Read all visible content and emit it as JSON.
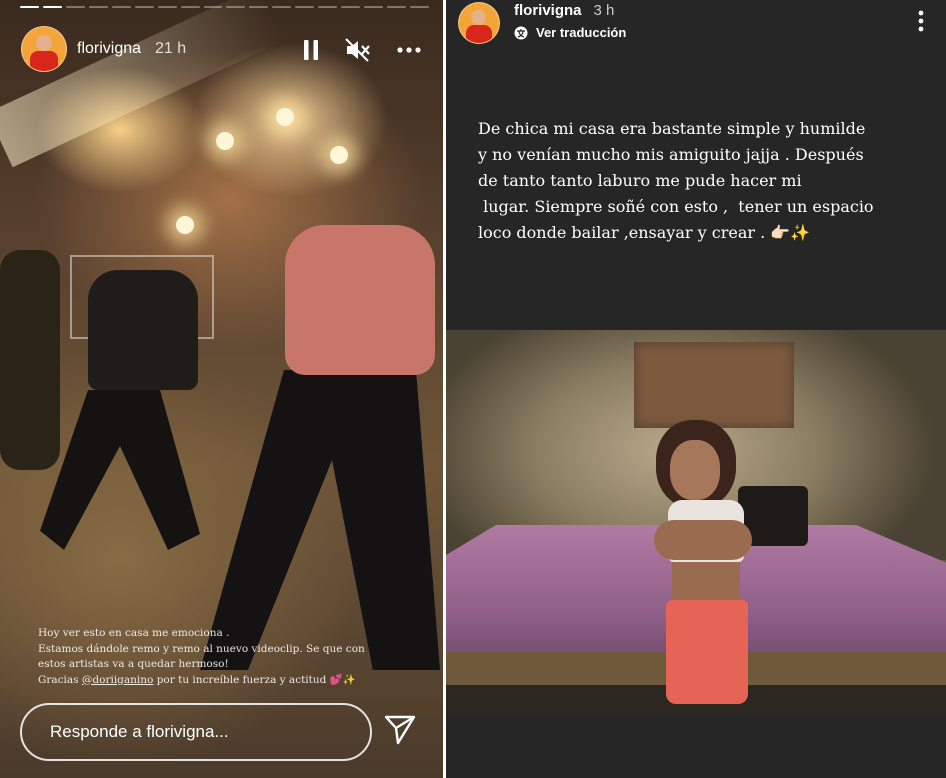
{
  "left_story": {
    "progress_segments": [
      {
        "done": true
      },
      {
        "done": true
      },
      {
        "done": false
      },
      {
        "done": false
      },
      {
        "done": false
      },
      {
        "done": false
      },
      {
        "done": false
      },
      {
        "done": false
      },
      {
        "done": false
      },
      {
        "done": false
      },
      {
        "done": false
      },
      {
        "done": false
      },
      {
        "done": false
      },
      {
        "done": false
      },
      {
        "done": false
      },
      {
        "done": false
      },
      {
        "done": false
      },
      {
        "done": false
      }
    ],
    "username": "florivigna",
    "time": "21 h",
    "caption": {
      "line1": "Hoy ver esto en casa me emociona .",
      "line2": "Estamos dándole remo y remo al nuevo videoclip. Se que con",
      "line3": "estos artistas va a quedar hermoso!",
      "line4_pre": "Gracias ",
      "line4_mention": "@doriiganino",
      "line4_post": " por tu increíble fuerza y actitud 💕✨"
    },
    "reply_placeholder": "Responde a florivigna..."
  },
  "right_story": {
    "username": "florivigna",
    "time": "3 h",
    "translate_label": "Ver traducción",
    "text_lines": [
      "De chica mi casa era bastante simple y humilde",
      "y no venían mucho mis amiguito jajja . Después",
      "de tanto tanto laburo me pude hacer mi",
      " lugar. Siempre soñé con esto ,  tener un espacio",
      "loco donde bailar ,ensayar y crear . 👉🏻✨"
    ]
  },
  "colors": {
    "story_dark": "#262626",
    "avatar_bg": "#f3a53a",
    "avatar_shirt": "#d9261c"
  }
}
